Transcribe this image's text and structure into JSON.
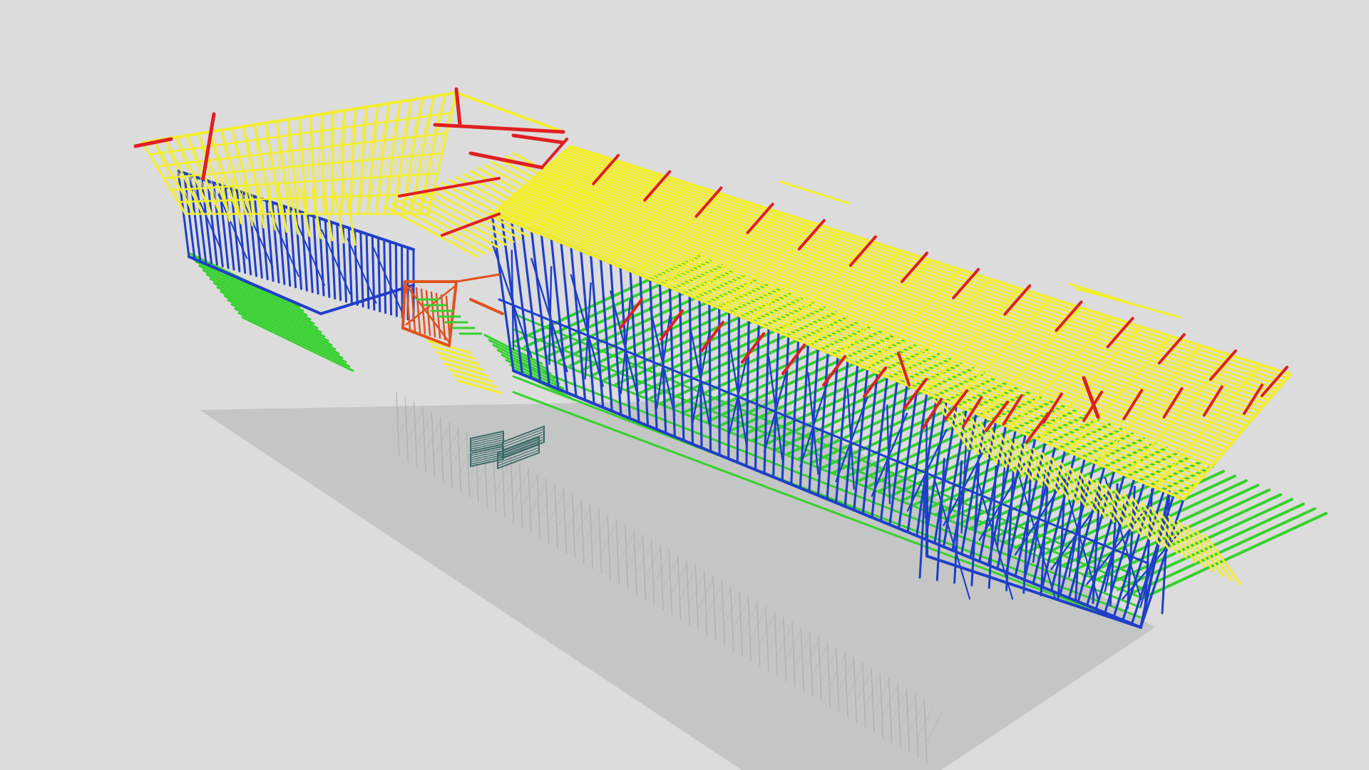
{
  "scene": {
    "background": "#dcdcdc",
    "ground_color": "#c4c6c6",
    "colors": {
      "roof_truss": "#f2ee2c",
      "wall_frame": "#1f3fc9",
      "floor_joist": "#36d12e",
      "rafter": "#e02020",
      "stair_frame": "#e0521e",
      "panel": "#3c6a6a"
    }
  }
}
